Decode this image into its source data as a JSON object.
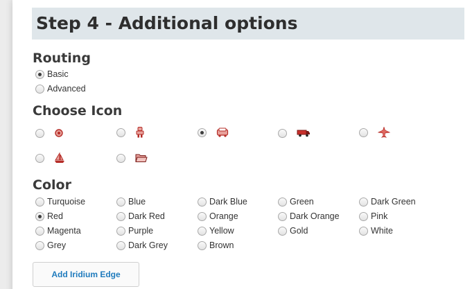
{
  "step_title": "Step 4 - Additional options",
  "routing": {
    "title": "Routing",
    "options": [
      {
        "label": "Basic",
        "checked": true
      },
      {
        "label": "Advanced",
        "checked": false
      }
    ]
  },
  "choose_icon": {
    "title": "Choose Icon",
    "icon_color": "#d9534f",
    "options": [
      {
        "icon": "dot-icon",
        "checked": false
      },
      {
        "icon": "person-icon",
        "checked": false
      },
      {
        "icon": "car-icon",
        "checked": true
      },
      {
        "icon": "truck-icon",
        "checked": false
      },
      {
        "icon": "airplane-icon",
        "checked": false
      },
      {
        "icon": "sailboat-icon",
        "checked": false
      },
      {
        "icon": "folder-icon",
        "checked": false
      }
    ]
  },
  "color": {
    "title": "Color",
    "selected": "Red",
    "options": [
      "Turquoise",
      "Blue",
      "Dark Blue",
      "Green",
      "Dark Green",
      "Red",
      "Dark Red",
      "Orange",
      "Dark Orange",
      "Pink",
      "Magenta",
      "Purple",
      "Yellow",
      "Gold",
      "White",
      "Grey",
      "Dark Grey",
      "Brown"
    ]
  },
  "add_button_label": "Add Iridium Edge",
  "accent_color": "#1f7bbd"
}
